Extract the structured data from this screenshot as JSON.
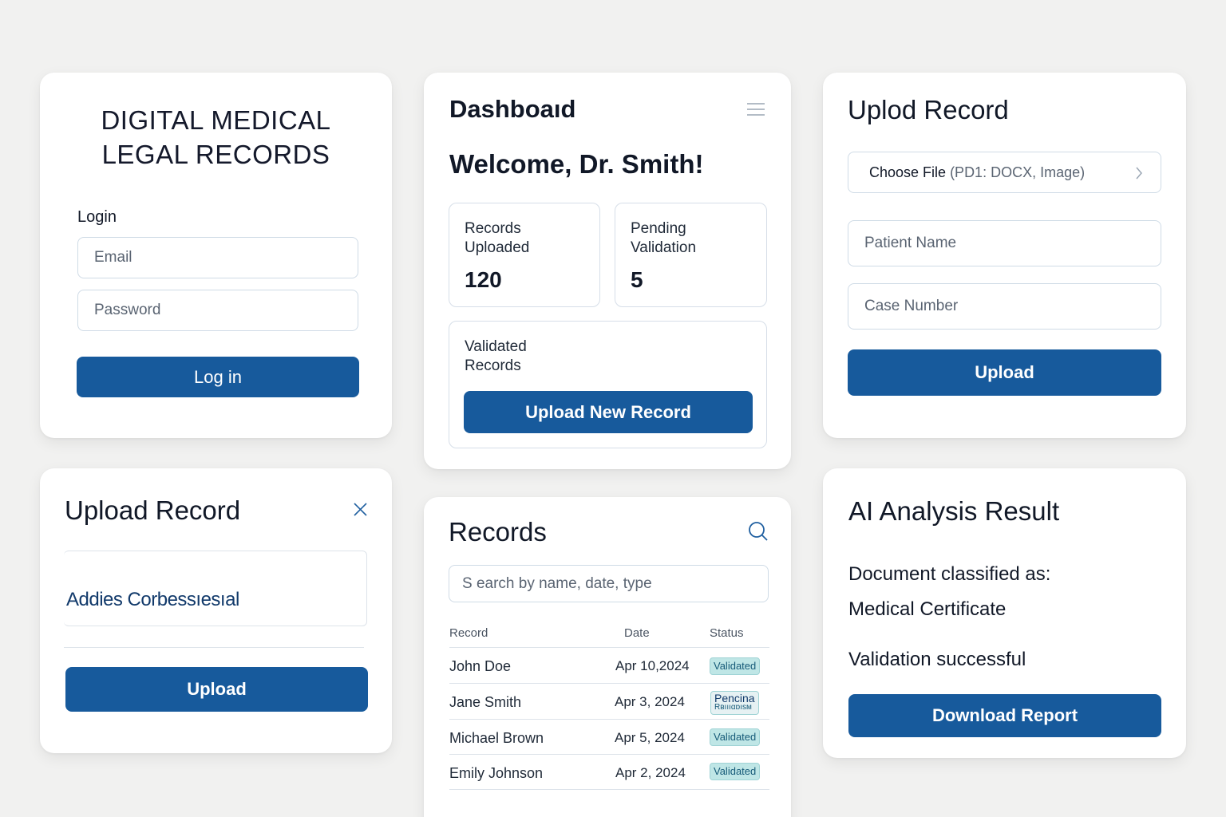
{
  "login": {
    "title_line1": "DIGITAL MEDICAL",
    "title_line2": "LEGAL RECORDS",
    "section_label": "Login",
    "email_placeholder": "Email",
    "password_placeholder": "Password",
    "login_button": "Log in"
  },
  "dashboard": {
    "title": "Dashboaıd",
    "welcome": "Welcome, Dr. Smith!",
    "stats": [
      {
        "label_line1": "Records",
        "label_line2": "Uploaded",
        "value": "120"
      },
      {
        "label_line1": "Pending",
        "label_line2": "Validation",
        "value": "5"
      },
      {
        "label_line1": "Validated",
        "label_line2": "Records"
      }
    ],
    "upload_new_button": "Upload New Record"
  },
  "upload_form": {
    "title": "Uplod Record",
    "choose_file": "Choose File",
    "choose_file_hint": "(PD1: DOCX, Image)",
    "patient_name_placeholder": "Patient Name",
    "case_number_placeholder": "Case Number",
    "upload_button": "Upload"
  },
  "upload_modal": {
    "title": "Upload Record",
    "field_value": "Addies Corbessıesıal",
    "upload_button": "Upload"
  },
  "records": {
    "title": "Records",
    "search_placeholder": "S earch by name, date, type",
    "columns": [
      "Record",
      "Date",
      "Status"
    ],
    "rows": [
      {
        "name": "John Doe",
        "date": "Apr 10,2024",
        "status": "Validated"
      },
      {
        "name": "Jane Smith",
        "date": "Apr 3, 2024",
        "status": "Pencina",
        "status_line2": "Rвıııαɒısм"
      },
      {
        "name": "Michael Brown",
        "date": "Apr 5, 2024",
        "status": "Validated"
      },
      {
        "name": "Emily Johnson",
        "date": "Apr 2, 2024",
        "status": "Validated"
      }
    ]
  },
  "ai": {
    "title": "AI Analysis Result",
    "line1": "Document classified as:",
    "line2": "Medical Certificate",
    "line3": "Validation successful",
    "download_button": "Download Report"
  },
  "colors": {
    "primary": "#175a9c",
    "background": "#f1f1f0",
    "badge_bg": "#bfe6e6",
    "border": "#cfdbe6"
  }
}
